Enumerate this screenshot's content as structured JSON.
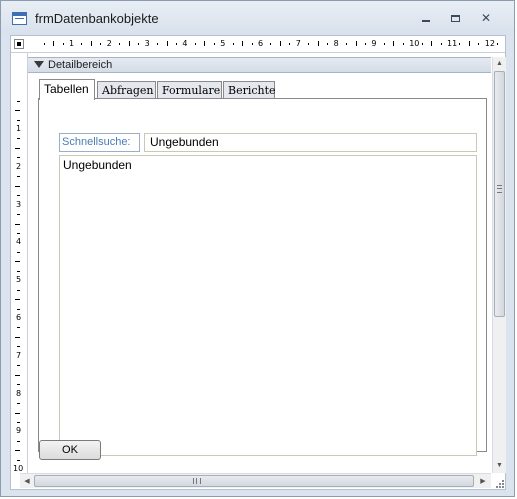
{
  "window": {
    "title": "frmDatenbankobjekte"
  },
  "ruler": {
    "h_numbers": [
      "1",
      "2",
      "3",
      "4",
      "5",
      "6",
      "7",
      "8",
      "9",
      "10",
      "11",
      "12"
    ],
    "v_numbers": [
      "1",
      "2",
      "3",
      "4",
      "5",
      "6",
      "7",
      "8",
      "9",
      "10"
    ]
  },
  "section": {
    "label": "Detailbereich"
  },
  "tabs": [
    {
      "label": "Tabellen"
    },
    {
      "label": "Abfragen"
    },
    {
      "label": "Formulare"
    },
    {
      "label": "Berichte"
    }
  ],
  "search": {
    "label": "Schnellsuche:",
    "value": "Ungebunden"
  },
  "list": {
    "value": "Ungebunden"
  },
  "ok_label": "OK"
}
